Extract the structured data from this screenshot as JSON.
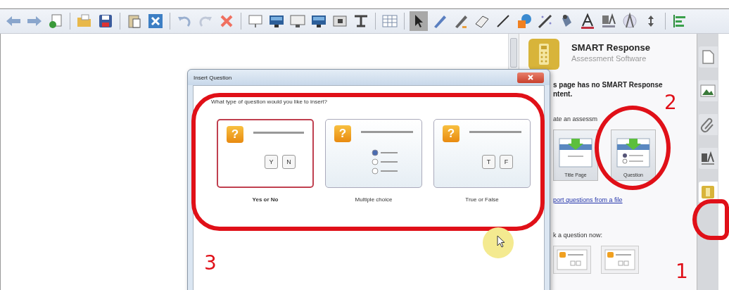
{
  "toolbar": {
    "groups": [
      [
        {
          "kind": "back",
          "selected": false
        },
        {
          "kind": "forward",
          "selected": false
        },
        {
          "kind": "new_page",
          "selected": false
        }
      ],
      [
        {
          "kind": "open",
          "selected": false
        },
        {
          "kind": "save",
          "selected": false
        }
      ],
      [
        {
          "kind": "paste",
          "selected": false
        },
        {
          "kind": "delete_page",
          "selected": false
        }
      ],
      [
        {
          "kind": "undo",
          "selected": false
        },
        {
          "kind": "redo",
          "selected": false
        },
        {
          "kind": "delete",
          "selected": false
        }
      ],
      [
        {
          "kind": "screen_shade",
          "selected": false
        },
        {
          "kind": "display",
          "selected": false
        },
        {
          "kind": "monitor",
          "selected": false
        },
        {
          "kind": "display",
          "selected": false
        },
        {
          "kind": "capture",
          "selected": false
        },
        {
          "kind": "text_tool",
          "selected": false
        }
      ],
      [
        {
          "kind": "table",
          "selected": false
        }
      ],
      [
        {
          "kind": "select",
          "selected": true
        },
        {
          "kind": "pen",
          "selected": false
        },
        {
          "kind": "creative_pen",
          "selected": false
        },
        {
          "kind": "eraser",
          "selected": false
        },
        {
          "kind": "line",
          "selected": false
        },
        {
          "kind": "shapes",
          "selected": false
        },
        {
          "kind": "magic_pen",
          "selected": false
        },
        {
          "kind": "fill",
          "selected": false
        },
        {
          "kind": "text_color",
          "selected": false
        },
        {
          "kind": "properties",
          "selected": false
        },
        {
          "kind": "measure",
          "selected": false
        },
        {
          "kind": "resize",
          "selected": false
        }
      ],
      [
        {
          "kind": "align",
          "selected": false
        }
      ]
    ]
  },
  "dialog": {
    "title": "Insert Question",
    "prompt": "What type of question would you like to insert?",
    "options": [
      {
        "kind": "yes_no",
        "label": "Yes or No",
        "badge": "?",
        "keys": [
          "Y",
          "N"
        ],
        "selected": true
      },
      {
        "kind": "multiple_choice",
        "label": "Multiple choice",
        "badge": "?",
        "selected": false
      },
      {
        "kind": "true_false",
        "label": "True or False",
        "badge": "?",
        "keys": [
          "T",
          "F"
        ],
        "selected": false
      }
    ]
  },
  "panel": {
    "title": "SMART Response",
    "subtitle": "Assessment Software",
    "message_lines": [
      "s page has no SMART Response",
      "ntent."
    ],
    "create_label": "ate an assessm",
    "create_buttons": [
      {
        "kind": "title_page",
        "label": "Title Page"
      },
      {
        "kind": "question",
        "label": "Question"
      }
    ],
    "import_link": "port questions from a file",
    "ask_label": "k a question now:"
  },
  "side_tabs": [
    {
      "kind": "page_sorter",
      "selected": false
    },
    {
      "kind": "gallery",
      "selected": false
    },
    {
      "kind": "attachments",
      "selected": false
    },
    {
      "kind": "properties",
      "selected": false
    },
    {
      "kind": "response",
      "selected": true
    }
  ],
  "annotations": [
    {
      "kind": "ellipse"
    },
    {
      "kind": "ellipse"
    },
    {
      "kind": "ellipse"
    },
    {
      "kind": "number",
      "text": "2"
    },
    {
      "kind": "number",
      "text": "1"
    },
    {
      "kind": "number",
      "text": "3"
    }
  ]
}
